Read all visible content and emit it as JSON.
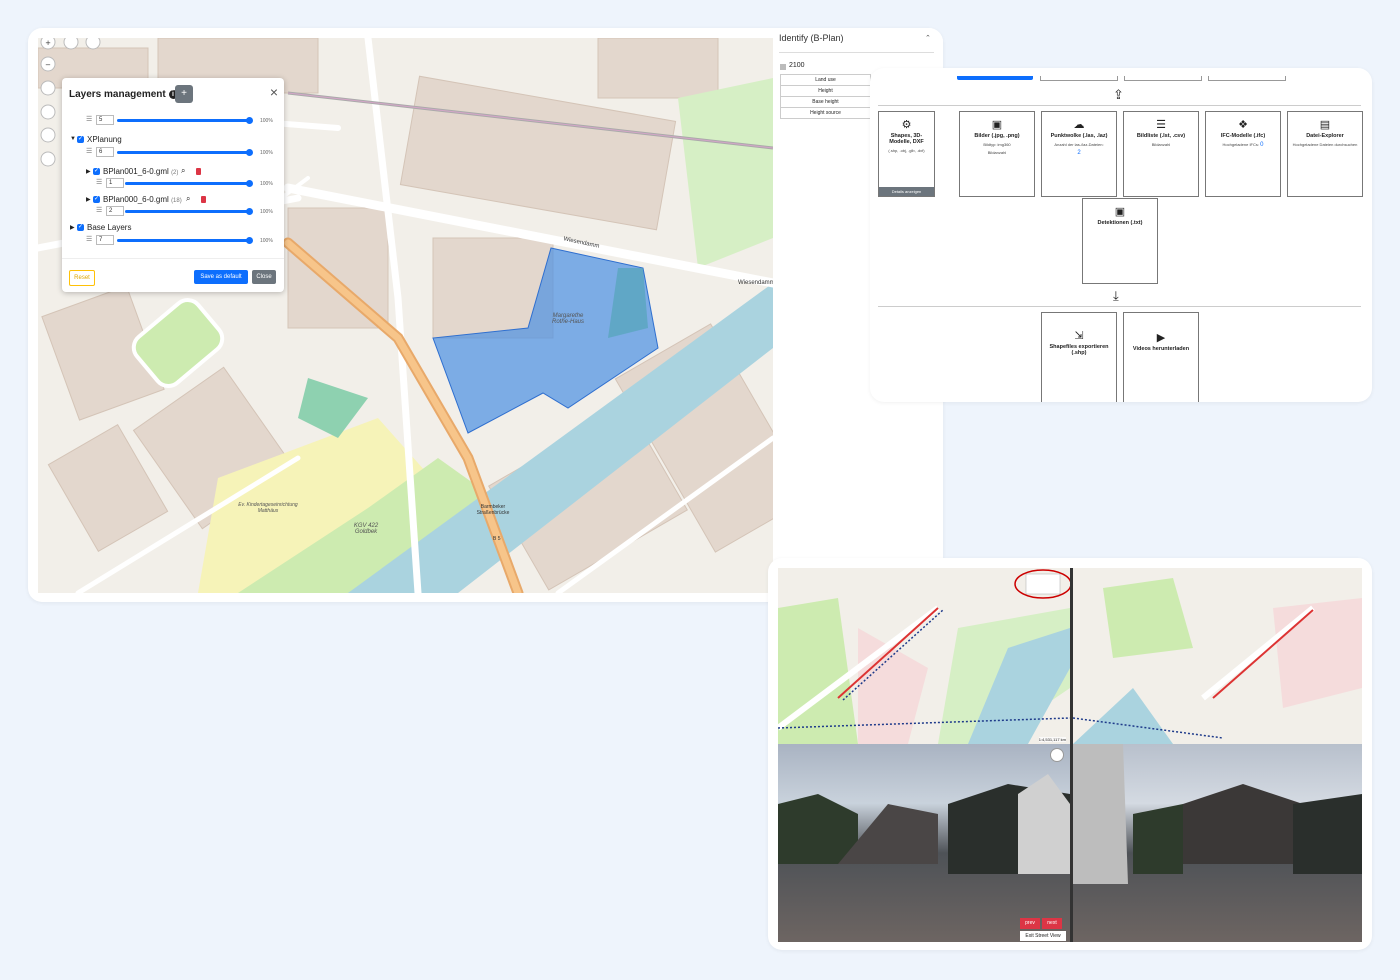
{
  "layers_panel": {
    "title": "Layers management",
    "add_label": "+",
    "close_icon": "×",
    "rows": [
      {
        "order": "5",
        "pct": "100%"
      },
      {
        "name": "XPlanung",
        "order": "6",
        "pct": "100%"
      },
      {
        "name": "BPlan001_6-0.gml",
        "count": "(2)",
        "order": "1",
        "pct": "100%"
      },
      {
        "name": "BPlan000_6-0.gml",
        "count": "(18)",
        "order": "2",
        "pct": "100%"
      },
      {
        "name": "Base Layers",
        "order": "7",
        "pct": "100%"
      }
    ],
    "reset_label": "Reset",
    "save_label": "Save as default",
    "close_label": "Close"
  },
  "map_labels": {
    "wiesendamm": "Wiesendamm",
    "place": "Margarethe Rothe-Haus",
    "kgv": "KGV 422 Goldbek",
    "bridge": "Barmbeker Straßenbrücke",
    "kita": "Ev. Kindertageseinrichtung Matthäus",
    "b5": "B 5"
  },
  "identify": {
    "title": "Identify (B-Plan)",
    "value": "2100",
    "rows": [
      "Land use",
      "Height",
      "Base height",
      "Height source"
    ]
  },
  "upload": {
    "tiles_row1": [
      {
        "title": "Shapes, 3D-Modelle, DXF",
        "sub": "(.shp, .obj, .glb, .dxf)",
        "icon": "3d-icon",
        "button": "Details anzeigen"
      },
      {
        "title": "Bilder (.jpg, .png)",
        "sub": "Bildtyp: img360",
        "sub2": "Bildanzahl",
        "icon": "image-icon"
      },
      {
        "title": "Punktwolke (.las, .laz)",
        "sub": "Anzahl der las-/laz-Dateien:",
        "value": "2",
        "icon": "cloud-icon"
      },
      {
        "title": "Bildliste (.lst, .csv)",
        "sub": "Bildanzahl",
        "icon": "list-icon"
      },
      {
        "title": "IFC-Modelle (.ifc)",
        "sub": "Hochgeladene IFCs:",
        "value": "0",
        "icon": "cubes-icon"
      },
      {
        "title": "Datei-Explorer",
        "sub": "Hochgeladene Dateien durchsuchen",
        "icon": "file-icon"
      }
    ],
    "tile_detect": {
      "title": "Detektionen (.txt)",
      "icon": "image-icon"
    },
    "tiles_export": [
      {
        "title": "Shapefiles exportieren (.shp)",
        "icon": "file-export-icon"
      },
      {
        "title": "Videos herunterladen",
        "icon": "file-video-icon"
      }
    ]
  },
  "street": {
    "scale": "1:4,531,117 km",
    "prev_label": "prev",
    "next_label": "next",
    "exit_label": "Exit Street View"
  }
}
